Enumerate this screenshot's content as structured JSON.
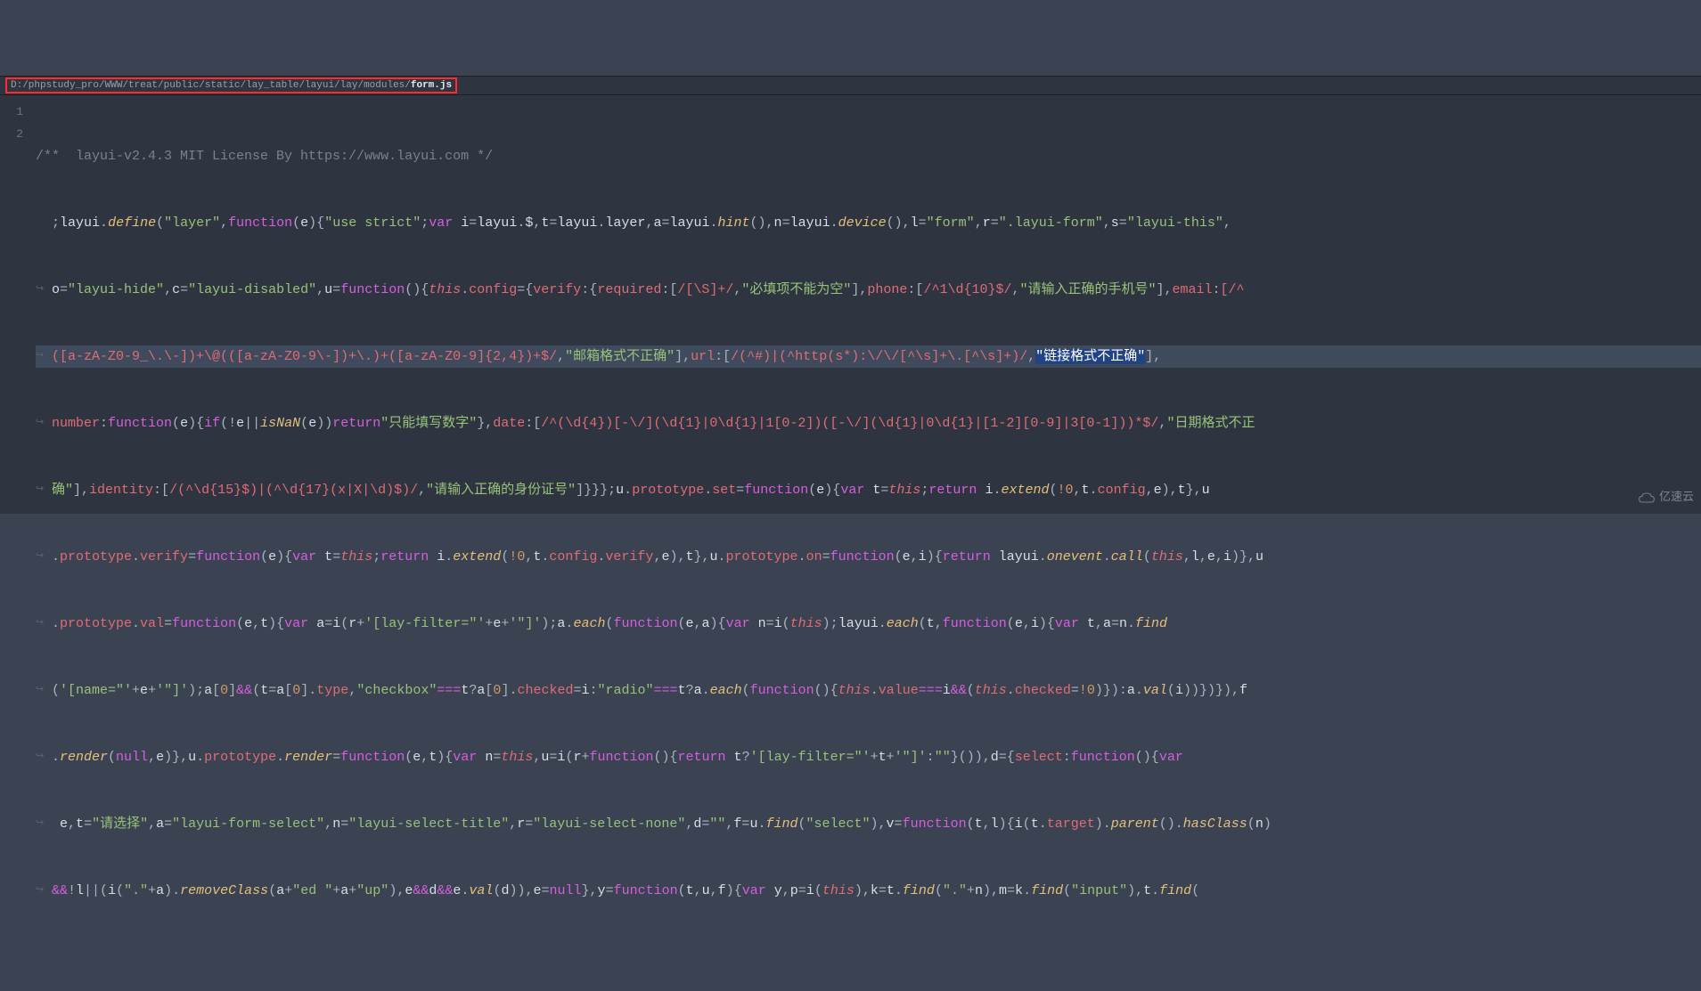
{
  "breadcrumb": {
    "path_prefix": "D:/phpstudy_pro/WWW/treat/public/static/lay_table/layui/lay/modules/",
    "file": "form.js"
  },
  "gutter": {
    "l1": "1",
    "l2": "2"
  },
  "tokens": {
    "comment_line": "/**  layui-v2.4.3 MIT License By https://www.layui.com */",
    "kw_var": "var",
    "kw_function": "function",
    "kw_return": "return",
    "kw_this": "this",
    "kw_null": "null",
    "s_layer": "\"layer\"",
    "s_use_strict": "\"use strict\"",
    "s_form": "\"form\"",
    "s_layui_form": "\".layui-form\"",
    "s_layui_this": "\"layui-this\"",
    "s_layui_hide": "\"layui-hide\"",
    "s_layui_disabled": "\"layui-disabled\"",
    "s_required_msg": "\"必填项不能为空\"",
    "s_phone_msg": "\"请输入正确的手机号\"",
    "s_email_msg": "\"邮箱格式不正确\"",
    "s_url_msg": "\"链接格式不正确\"",
    "s_number_msg": "\"只能填写数字\"",
    "s_date_msg": "\"日期格式不正确\"",
    "s_identity_msg": "\"请输入正确的身份证号\"",
    "s_lay_filter_open": "'[lay-filter=\"'",
    "s_lay_filter_close": "'\"]'",
    "s_name_open": "'[name=\"'",
    "s_name_close": "'\"]'",
    "s_checkbox": "\"checkbox\"",
    "s_radio": "\"radio\"",
    "s_please_select": "\"请选择\"",
    "s_layui_form_select": "\"layui-form-select\"",
    "s_layui_select_title": "\"layui-select-title\"",
    "s_layui_select_none": "\"layui-select-none\"",
    "s_empty": "\"\"",
    "s_select": "\"select\"",
    "s_dot": "\".\"",
    "s_ed_sp": "\"ed \"",
    "s_up": "\"up\"",
    "s_input": "\"input\"",
    "re_required": "/[\\S]+/",
    "re_phone": "/^1\\d{10}$/",
    "re_email_a": "([a-zA-Z0-9_\\.\\-])+\\@(([a-zA-Z0-9\\-])+\\.)+([a-zA-Z0-9]{2,4})+$/",
    "re_url": "/(^#)|(^http(s*):\\/\\/[^\\s]+\\.[^\\s]+)/",
    "re_date": "/^(\\d{4})[-\\/](\\d{1}|0\\d{1}|1[0-2])([-\\/](\\d{1}|0\\d{1}|[1-2][0-9]|3[0-1]))*$/",
    "re_identity": "/(^\\d{15}$)|(^\\d{17}(x|X|\\d)$)/",
    "fn_define": "define",
    "fn_hint": "hint",
    "fn_device": "device",
    "fn_isNaN": "isNaN",
    "fn_extend": "extend",
    "fn_onevent": "onevent",
    "fn_call": "call",
    "fn_each": "each",
    "fn_find": "find",
    "fn_render": "render",
    "fn_parent": "parent",
    "fn_hasClass": "hasClass",
    "fn_removeClass": "removeClass",
    "fn_val": "val",
    "p_config": "config",
    "p_verify": "verify",
    "p_required": "required",
    "p_phone": "phone",
    "p_email": "email",
    "p_url": "url",
    "p_number": "number",
    "p_date": "date",
    "p_identity": "identity",
    "p_prototype": "prototype",
    "p_set": "set",
    "p_on": "on",
    "p_val": "val",
    "p_type": "type",
    "p_checked": "checked",
    "p_value": "value",
    "p_select": "select",
    "p_target": "target",
    "id_layui": "layui",
    "id_i": "i",
    "id_t": "t",
    "id_a": "a",
    "id_n": "n",
    "id_l": "l",
    "id_r": "r",
    "id_s": "s",
    "id_o": "o",
    "id_c": "c",
    "id_u": "u",
    "id_e": "e",
    "id_d": "d",
    "id_f": "f",
    "id_v": "v",
    "id_y": "y",
    "id_p": "p",
    "id_k": "k",
    "id_m": "m",
    "id_dollar": "$",
    "id_layer": "layer",
    "num_0": "0",
    "bool_not0": "!0"
  },
  "watermark": {
    "text": "亿速云"
  }
}
